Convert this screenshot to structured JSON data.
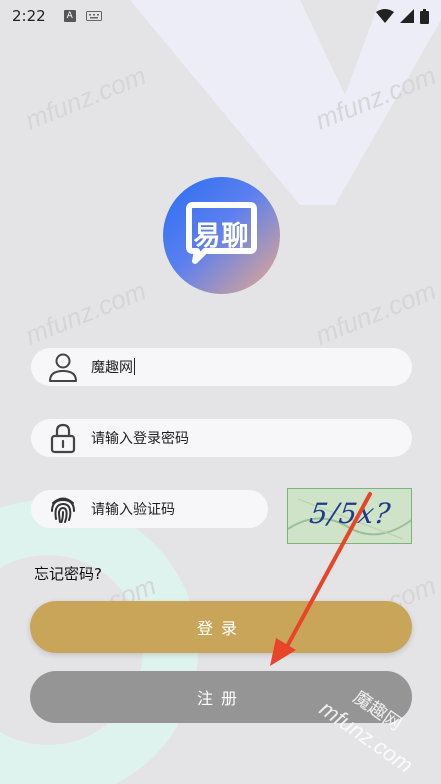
{
  "status_bar": {
    "time": "2:22",
    "keyboard_badge": "A"
  },
  "logo": {
    "text": "易聊"
  },
  "form": {
    "username_value": "魔趣网",
    "password_placeholder": "请输入登录密码",
    "captcha_placeholder": "请输入验证码",
    "captcha_image_text": "5/5x?"
  },
  "links": {
    "forgot_password": "忘记密码?"
  },
  "buttons": {
    "login": "登录",
    "register": "注册"
  },
  "watermarks": {
    "site": "mfunz.com",
    "corner_stamp": "魔趣网"
  },
  "colors": {
    "background": "#e4e4e6",
    "login_button": "#c9a55a",
    "register_button": "#959595",
    "annotation_arrow": "#e8442a"
  }
}
